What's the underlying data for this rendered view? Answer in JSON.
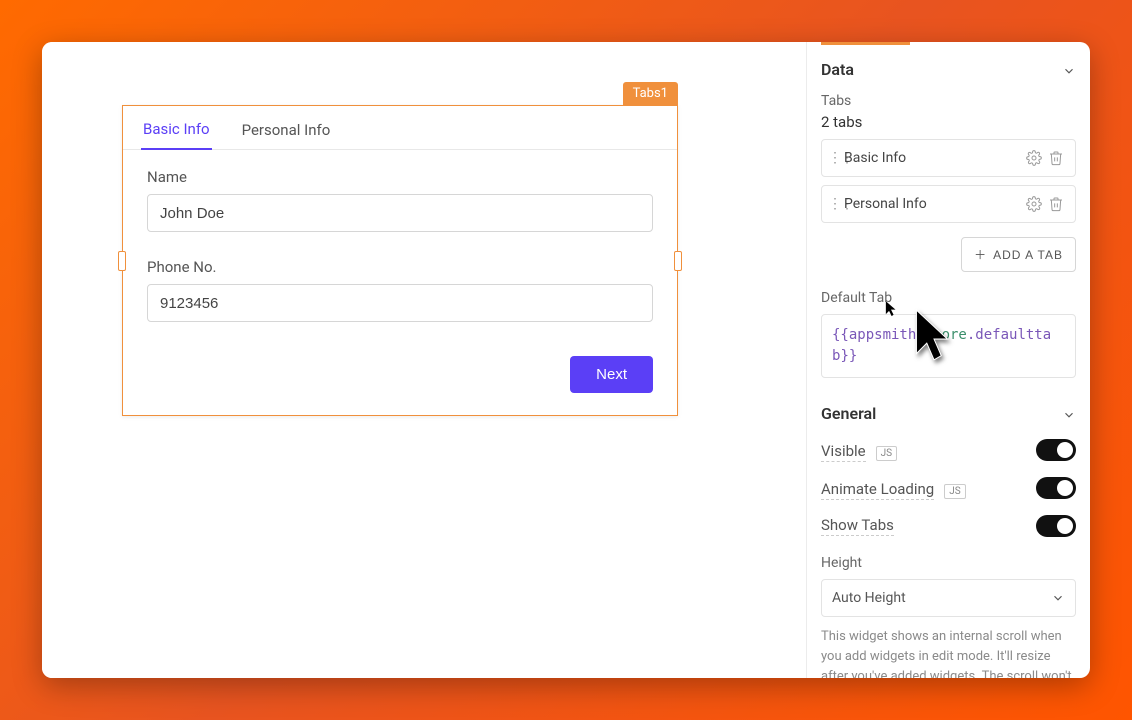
{
  "widget": {
    "label": "Tabs1",
    "tabs": [
      "Basic Info",
      "Personal Info"
    ],
    "active_tab": "Basic Info",
    "fields": {
      "name_label": "Name",
      "name_value": "John Doe",
      "phone_label": "Phone No.",
      "phone_value": "9123456"
    },
    "next_button": "Next"
  },
  "panel": {
    "sections": {
      "data": "Data",
      "general": "General"
    },
    "tabs_label": "Tabs",
    "tabs_count_text": "2 tabs",
    "tab_rows": [
      "Basic Info",
      "Personal Info"
    ],
    "add_tab_label": "ADD A TAB",
    "default_tab_label": "Default Tab",
    "default_tab_code": "{{appsmith.store.defaulttab}}",
    "visible_label": "Visible",
    "animate_label": "Animate Loading",
    "show_tabs_label": "Show Tabs",
    "height_label": "Height",
    "height_value": "Auto Height",
    "help_text": "This widget shows an internal scroll when you add widgets in edit mode. It'll resize after you've added widgets. The scroll won't exist in view mode.",
    "js_badge": "JS",
    "toggles": {
      "visible": true,
      "animate": true,
      "show_tabs": true
    }
  }
}
